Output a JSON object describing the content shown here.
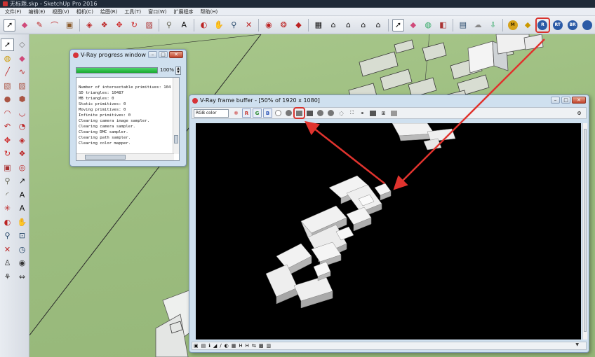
{
  "app": {
    "title": "无标题.skp - SketchUp Pro 2016"
  },
  "menu": [
    "文件(F)",
    "编辑(E)",
    "视图(V)",
    "相机(C)",
    "绘图(R)",
    "工具(T)",
    "窗口(W)",
    "扩展程序",
    "帮助(H)"
  ],
  "toolbar": {
    "buttons": [
      "select-arrow",
      "eraser",
      "pencil",
      "arc",
      "paint-bucket",
      "push-pull",
      "move",
      "rotate",
      "scale",
      "offset",
      "tape-measure",
      "text",
      "orbit",
      "pan",
      "zoom",
      "zoom-extents",
      "warehouse",
      "component",
      "extension",
      "iso",
      "top",
      "front",
      "right",
      "back",
      "select",
      "eraser",
      "paint",
      "push",
      "vray-material",
      "vray-options",
      "vray-render",
      "vray-rt",
      "vray-batch",
      "vray-frame"
    ],
    "vray_labels": [
      "M",
      "",
      "R",
      "RT",
      "BR",
      ""
    ]
  },
  "progress_window": {
    "title": "V-Ray progress window",
    "percent_label": "100%",
    "progress": 1.0,
    "log": [
      "Number of intersectable primitives: 104",
      "SD triangles: 10487",
      "MB triangles: 0",
      "Static primitives: 0",
      "Moving primitives: 0",
      "Infinite primitives: 0",
      "Clearing camera image sampler.",
      "Clearing camera sampler.",
      "Clearing DMC sampler.",
      "Clearing path sampler.",
      "Clearing color mapper."
    ]
  },
  "frame_buffer": {
    "title": "V-Ray frame buffer - [50% of 1920 x 1080]",
    "channel_select": "RGB color",
    "channels": [
      "R",
      "G",
      "B"
    ]
  },
  "colors": {
    "highlight": "#d8332e",
    "progress": "#16a82f",
    "viewport": "#9cbd7f"
  }
}
